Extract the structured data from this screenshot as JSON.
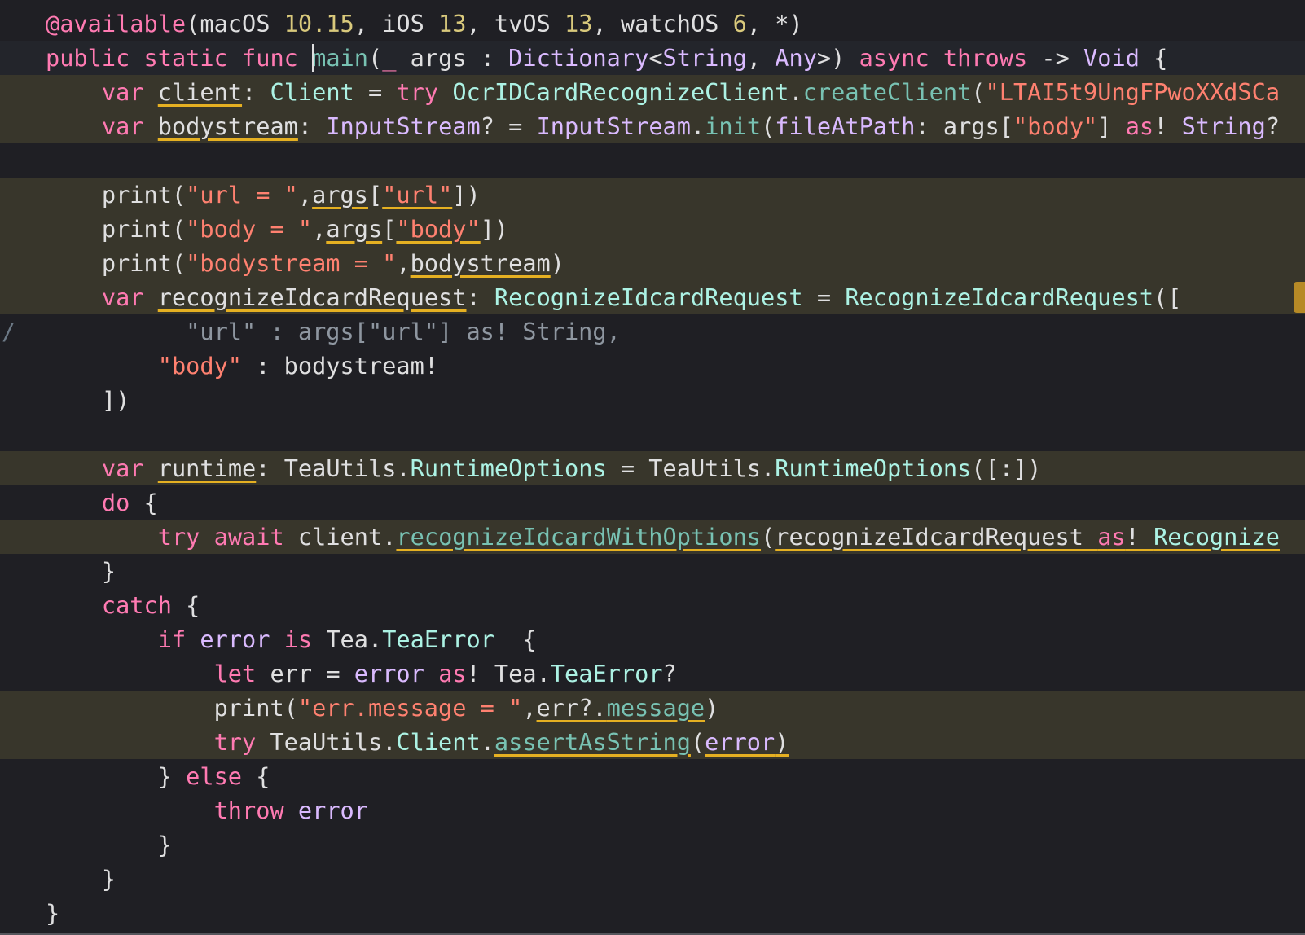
{
  "editor": {
    "lines": [
      [
        [
          "@available",
          "kw"
        ],
        [
          "(macOS ",
          "pl"
        ],
        [
          "10.15",
          "nu"
        ],
        [
          ", iOS ",
          "pl"
        ],
        [
          "13",
          "nu"
        ],
        [
          ", tvOS ",
          "pl"
        ],
        [
          "13",
          "nu"
        ],
        [
          ", watchOS ",
          "pl"
        ],
        [
          "6",
          "nu"
        ],
        [
          ", *)",
          "pl"
        ]
      ],
      [
        [
          "public ",
          "kw"
        ],
        [
          "static ",
          "kw"
        ],
        [
          "func ",
          "kw"
        ],
        [
          "main",
          "fn"
        ],
        [
          "(",
          "pl"
        ],
        [
          "_",
          "kw"
        ],
        [
          " args : ",
          "pl"
        ],
        [
          "Dictionary",
          "ty"
        ],
        [
          "<",
          "pl"
        ],
        [
          "String",
          "ty"
        ],
        [
          ", ",
          "pl"
        ],
        [
          "Any",
          "ty"
        ],
        [
          ">) ",
          "pl"
        ],
        [
          "async ",
          "kw"
        ],
        [
          "throws ",
          "kw"
        ],
        [
          "-> ",
          "pl"
        ],
        [
          "Void",
          "ty"
        ],
        [
          " {",
          "pl"
        ]
      ],
      [
        [
          "    ",
          "pl"
        ],
        [
          "var ",
          "kw"
        ],
        [
          "client",
          "pl"
        ],
        [
          ": ",
          "pl"
        ],
        [
          "Client",
          "ty2"
        ],
        [
          " = ",
          "pl"
        ],
        [
          "try ",
          "kw"
        ],
        [
          "OcrIDCardRecognizeClient",
          "ty2"
        ],
        [
          ".",
          "pl"
        ],
        [
          "createClient",
          "fn"
        ],
        [
          "(",
          "pl"
        ],
        [
          "\"LTAI5t9UngFPwoXXdSCa",
          "st"
        ]
      ],
      [
        [
          "    ",
          "pl"
        ],
        [
          "var ",
          "kw"
        ],
        [
          "bodystream",
          "pl"
        ],
        [
          ": ",
          "pl"
        ],
        [
          "InputStream",
          "ty"
        ],
        [
          "? = ",
          "pl"
        ],
        [
          "InputStream",
          "ty"
        ],
        [
          ".",
          "pl"
        ],
        [
          "init",
          "fn"
        ],
        [
          "(",
          "pl"
        ],
        [
          "fileAtPath",
          "ty"
        ],
        [
          ": args[",
          "pl"
        ],
        [
          "\"body\"",
          "st"
        ],
        [
          "] ",
          "pl"
        ],
        [
          "as",
          "kw"
        ],
        [
          "! ",
          "pl"
        ],
        [
          "String",
          "ty"
        ],
        [
          "?",
          "pl"
        ]
      ],
      [],
      [
        [
          "    print(",
          "pl"
        ],
        [
          "\"url = \"",
          "st"
        ],
        [
          ",",
          "pl"
        ],
        [
          "args",
          "pl"
        ],
        [
          "[",
          "pl"
        ],
        [
          "\"url\"",
          "st"
        ],
        [
          "])",
          "pl"
        ]
      ],
      [
        [
          "    print(",
          "pl"
        ],
        [
          "\"body = \"",
          "st"
        ],
        [
          ",",
          "pl"
        ],
        [
          "args",
          "pl"
        ],
        [
          "[",
          "pl"
        ],
        [
          "\"body\"",
          "st"
        ],
        [
          "])",
          "pl"
        ]
      ],
      [
        [
          "    print(",
          "pl"
        ],
        [
          "\"bodystream = \"",
          "st"
        ],
        [
          ",",
          "pl"
        ],
        [
          "bodystream",
          "pl"
        ],
        [
          ")",
          "pl"
        ]
      ],
      [
        [
          "    ",
          "pl"
        ],
        [
          "var ",
          "kw"
        ],
        [
          "recognizeIdcardRequest",
          "pl"
        ],
        [
          ": ",
          "pl"
        ],
        [
          "RecognizeIdcardRequest",
          "ty2"
        ],
        [
          " = ",
          "pl"
        ],
        [
          "RecognizeIdcardRequest",
          "ty2"
        ],
        [
          "([",
          "pl"
        ]
      ],
      [
        [
          "          \"url\" : args[\"url\"] as! String,",
          "cm"
        ]
      ],
      [
        [
          "        ",
          "pl"
        ],
        [
          "\"body\"",
          "st"
        ],
        [
          " : bodystream!",
          "pl"
        ]
      ],
      [
        [
          "    ])",
          "pl"
        ]
      ],
      [],
      [
        [
          "    ",
          "pl"
        ],
        [
          "var ",
          "kw"
        ],
        [
          "runtime",
          "pl"
        ],
        [
          ": TeaUtils.",
          "pl"
        ],
        [
          "RuntimeOptions",
          "ty2"
        ],
        [
          " = TeaUtils.",
          "pl"
        ],
        [
          "RuntimeOptions",
          "ty2"
        ],
        [
          "([:])",
          "pl"
        ]
      ],
      [
        [
          "    ",
          "pl"
        ],
        [
          "do",
          "kw"
        ],
        [
          " {",
          "pl"
        ]
      ],
      [
        [
          "        ",
          "pl"
        ],
        [
          "try ",
          "kw"
        ],
        [
          "await ",
          "kw"
        ],
        [
          "client.",
          "pl"
        ],
        [
          "recognizeIdcardWithOptions",
          "fn"
        ],
        [
          "(",
          "pl"
        ],
        [
          "recognizeIdcardRequest ",
          "pl"
        ],
        [
          "as",
          "kw"
        ],
        [
          "! ",
          "pl"
        ],
        [
          "Recognize",
          "ty2"
        ]
      ],
      [
        [
          "    }",
          "pl"
        ]
      ],
      [
        [
          "    ",
          "pl"
        ],
        [
          "catch",
          "kw"
        ],
        [
          " {",
          "pl"
        ]
      ],
      [
        [
          "        ",
          "pl"
        ],
        [
          "if ",
          "kw"
        ],
        [
          "error",
          "ty"
        ],
        [
          " ",
          "pl"
        ],
        [
          "is",
          "kw"
        ],
        [
          " Tea.",
          "pl"
        ],
        [
          "TeaError",
          "ty2"
        ],
        [
          "  {",
          "pl"
        ]
      ],
      [
        [
          "            ",
          "pl"
        ],
        [
          "let ",
          "kw"
        ],
        [
          "err = ",
          "pl"
        ],
        [
          "error",
          "ty"
        ],
        [
          " ",
          "pl"
        ],
        [
          "as",
          "kw"
        ],
        [
          "! Tea.",
          "pl"
        ],
        [
          "TeaError",
          "ty2"
        ],
        [
          "?",
          "pl"
        ]
      ],
      [
        [
          "            print(",
          "pl"
        ],
        [
          "\"err.message = \"",
          "st"
        ],
        [
          ",",
          "pl"
        ],
        [
          "err?.",
          "pl"
        ],
        [
          "message",
          "fn"
        ],
        [
          ")",
          "pl"
        ]
      ],
      [
        [
          "            ",
          "pl"
        ],
        [
          "try ",
          "kw"
        ],
        [
          "TeaUtils.",
          "pl"
        ],
        [
          "Client",
          "ty2"
        ],
        [
          ".",
          "pl"
        ],
        [
          "assertAsString",
          "fn"
        ],
        [
          "(",
          "pl"
        ],
        [
          "error",
          "ty"
        ],
        [
          ")",
          "pl"
        ]
      ],
      [
        [
          "        } ",
          "pl"
        ],
        [
          "else",
          "kw"
        ],
        [
          " {",
          "pl"
        ]
      ],
      [
        [
          "            ",
          "pl"
        ],
        [
          "throw ",
          "kw"
        ],
        [
          "error",
          "ty"
        ]
      ],
      [
        [
          "        }",
          "pl"
        ]
      ],
      [
        [
          "    }",
          "pl"
        ]
      ],
      [
        [
          "}",
          "pl"
        ]
      ]
    ]
  }
}
